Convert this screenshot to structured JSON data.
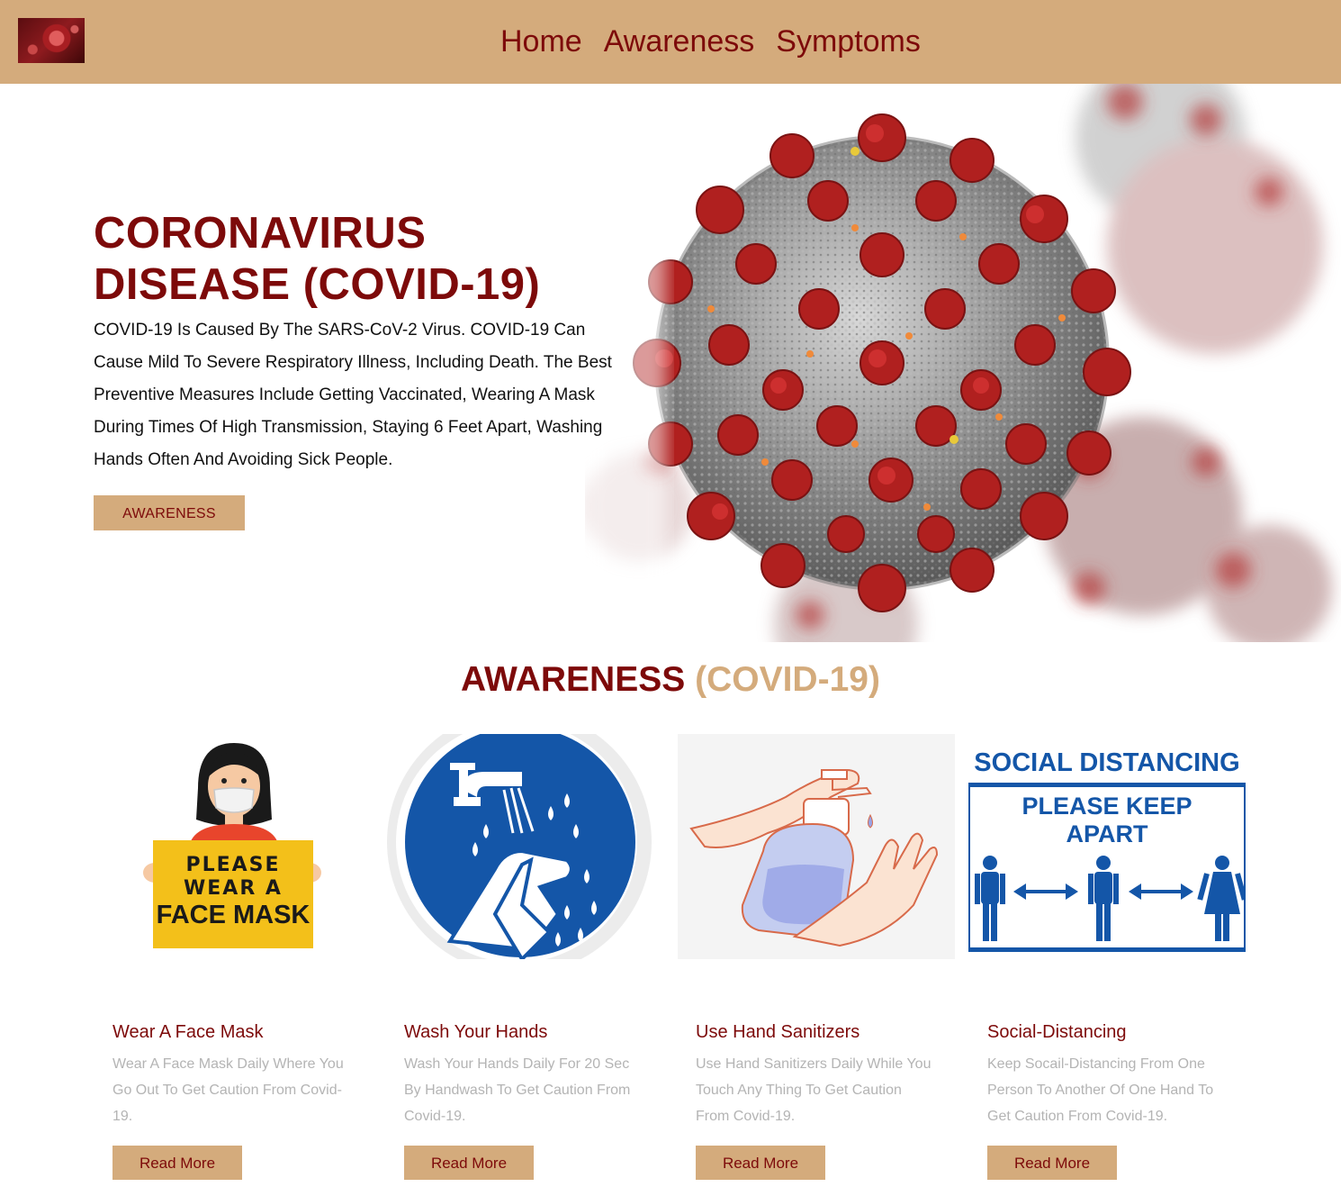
{
  "nav": {
    "logo_alt": "coronavirus logo",
    "links": [
      "Home",
      "Awareness",
      "Symptoms"
    ]
  },
  "hero": {
    "title_line1": "CORONAVIRUS",
    "title_line2": "DISEASE (COVID-19)",
    "text": "COVID-19 Is Caused By The SARS-CoV-2 Virus. COVID-19 Can Cause Mild To Severe Respiratory Illness, Including Death. The Best Preventive Measures Include Getting Vaccinated, Wearing A Mask During Times Of High Transmission, Staying 6 Feet Apart, Washing Hands Often And Avoiding Sick People.",
    "button": "AWARENESS"
  },
  "awareness": {
    "title_main": "AWARENESS",
    "title_accent": "(COVID-19)",
    "cards": [
      {
        "img_text": [
          "PLEASE",
          "WEAR A",
          "FACE MASK"
        ],
        "title": "Wear A Face Mask",
        "text": "Wear A Face Mask Daily Where You Go Out To Get Caution From Covid-19.",
        "button": "Read More"
      },
      {
        "title": "Wash Your Hands",
        "text": "Wash Your Hands Daily For 20 Sec By Handwash To Get Caution From Covid-19.",
        "button": "Read More"
      },
      {
        "title": "Use Hand Sanitizers",
        "text": "Use Hand Sanitizers Daily While You Touch Any Thing To Get Caution From Covid-19.",
        "button": "Read More"
      },
      {
        "img_text": [
          "SOCIAL DISTANCING",
          "PLEASE KEEP",
          "APART"
        ],
        "title": "Social-Distancing",
        "text": "Keep Socail-Distancing From One Person To Another Of One Hand To Get Caution From Covid-19.",
        "button": "Read More"
      }
    ]
  },
  "colors": {
    "primary": "#7d0a0a",
    "accent": "#d4ab7c",
    "muted_text": "#b4b4b4",
    "sign_blue": "#1456a8",
    "sign_yellow": "#f3c01a"
  }
}
